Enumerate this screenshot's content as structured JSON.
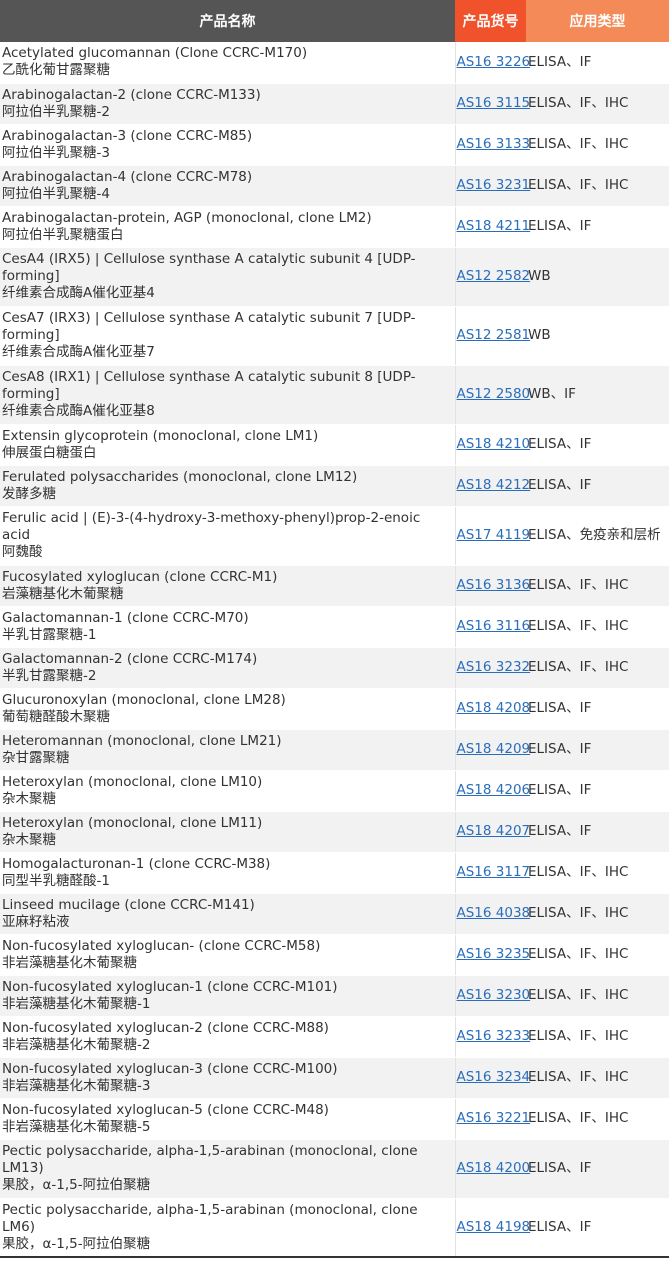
{
  "header": {
    "col_name": "产品名称",
    "col_code": "产品货号",
    "col_app": "应用类型"
  },
  "rows": [
    {
      "en": "Acetylated glucomannan (Clone CCRC-M170)",
      "zh": "乙酰化葡甘露聚糖",
      "code": "AS16 3226",
      "app": "ELISA、IF"
    },
    {
      "en": "Arabinogalactan-2 (clone CCRC-M133)",
      "zh": "阿拉伯半乳聚糖-2",
      "code": "AS16 3115",
      "app": "ELISA、IF、IHC"
    },
    {
      "en": "Arabinogalactan-3 (clone CCRC-M85)",
      "zh": "阿拉伯半乳聚糖-3",
      "code": "AS16 3133",
      "app": "ELISA、IF、IHC"
    },
    {
      "en": "Arabinogalactan-4 (clone CCRC-M78)",
      "zh": "阿拉伯半乳聚糖-4",
      "code": "AS16 3231",
      "app": "ELISA、IF、IHC"
    },
    {
      "en": "Arabinogalactan-protein, AGP (monoclonal, clone LM2)",
      "zh": "阿拉伯半乳聚糖蛋白",
      "code": "AS18 4211",
      "app": "ELISA、IF"
    },
    {
      "en": "CesA4 (IRX5) | Cellulose synthase A catalytic subunit 4 [UDP-forming]",
      "zh": "纤维素合成酶A催化亚基4",
      "code": "AS12 2582",
      "app": "WB"
    },
    {
      "en": "CesA7 (IRX3) | Cellulose synthase A catalytic subunit 7 [UDP-forming]",
      "zh": "纤维素合成酶A催化亚基7",
      "code": "AS12 2581",
      "app": "WB"
    },
    {
      "en": "CesA8 (IRX1) | Cellulose synthase A catalytic subunit 8 [UDP-forming]",
      "zh": "纤维素合成酶A催化亚基8",
      "code": "AS12 2580",
      "app": "WB、IF"
    },
    {
      "en": "Extensin glycoprotein (monoclonal, clone LM1)",
      "zh": "伸展蛋白糖蛋白",
      "code": "AS18 4210",
      "app": "ELISA、IF"
    },
    {
      "en": "Ferulated polysaccharides (monoclonal, clone LM12)",
      "zh": "发酵多糖",
      "code": "AS18 4212",
      "app": "ELISA、IF"
    },
    {
      "en": "Ferulic acid | (E)-3-(4-hydroxy-3-methoxy-phenyl)prop-2-enoic acid",
      "zh": "阿魏酸",
      "code": "AS17 4119",
      "app": "ELISA、免疫亲和层析"
    },
    {
      "en": "Fucosylated xyloglucan (clone CCRC-M1)",
      "zh": "岩藻糖基化木葡聚糖",
      "code": "AS16 3136",
      "app": "ELISA、IF、IHC"
    },
    {
      "en": "Galactomannan-1 (clone CCRC-M70)",
      "zh": "半乳甘露聚糖-1",
      "code": "AS16 3116",
      "app": "ELISA、IF、IHC"
    },
    {
      "en": "Galactomannan-2 (clone CCRC-M174)",
      "zh": "半乳甘露聚糖-2",
      "code": "AS16 3232",
      "app": "ELISA、IF、IHC"
    },
    {
      "en": "Glucuronoxylan (monoclonal, clone LM28)",
      "zh": "葡萄糖醛酸木聚糖",
      "code": "AS18 4208",
      "app": "ELISA、IF"
    },
    {
      "en": "Heteromannan (monoclonal, clone LM21)",
      "zh": "杂甘露聚糖",
      "code": "AS18 4209",
      "app": "ELISA、IF"
    },
    {
      "en": "Heteroxylan (monoclonal, clone LM10)",
      "zh": "杂木聚糖",
      "code": "AS18 4206",
      "app": "ELISA、IF"
    },
    {
      "en": "Heteroxylan (monoclonal, clone LM11)",
      "zh": "杂木聚糖",
      "code": "AS18 4207",
      "app": "ELISA、IF"
    },
    {
      "en": "Homogalacturonan-1 (clone CCRC-M38)",
      "zh": "同型半乳糖醛酸-1",
      "code": "AS16 3117",
      "app": "ELISA、IF、IHC"
    },
    {
      "en": "Linseed mucilage (clone CCRC-M141)",
      "zh": "亚麻籽粘液",
      "code": "AS16 4038",
      "app": "ELISA、IF、IHC"
    },
    {
      "en": "Non-fucosylated xyloglucan- (clone CCRC-M58)",
      "zh": "非岩藻糖基化木葡聚糖",
      "code": "AS16 3235",
      "app": "ELISA、IF、IHC"
    },
    {
      "en": "Non-fucosylated xyloglucan-1 (clone CCRC-M101)",
      "zh": "非岩藻糖基化木葡聚糖-1",
      "code": "AS16 3230",
      "app": "ELISA、IF、IHC"
    },
    {
      "en": "Non-fucosylated xyloglucan-2 (clone CCRC-M88)",
      "zh": "非岩藻糖基化木葡聚糖-2",
      "code": "AS16 3233",
      "app": "ELISA、IF、IHC"
    },
    {
      "en": "Non-fucosylated xyloglucan-3 (clone CCRC-M100)",
      "zh": "非岩藻糖基化木葡聚糖-3",
      "code": "AS16 3234",
      "app": "ELISA、IF、IHC"
    },
    {
      "en": "Non-fucosylated xyloglucan-5 (clone CCRC-M48)",
      "zh": "非岩藻糖基化木葡聚糖-5",
      "code": "AS16 3221",
      "app": "ELISA、IF、IHC"
    },
    {
      "en": "Pectic polysaccharide, alpha-1,5-arabinan (monoclonal, clone LM13)",
      "zh": "果胶，α-1,5-阿拉伯聚糖",
      "code": "AS18 4200",
      "app": "ELISA、IF"
    },
    {
      "en": "Pectic polysaccharide, alpha-1,5-arabinan (monoclonal, clone LM6)",
      "zh": "果胶，α-1,5-阿拉伯聚糖",
      "code": "AS18 4198",
      "app": "ELISA、IF"
    }
  ]
}
